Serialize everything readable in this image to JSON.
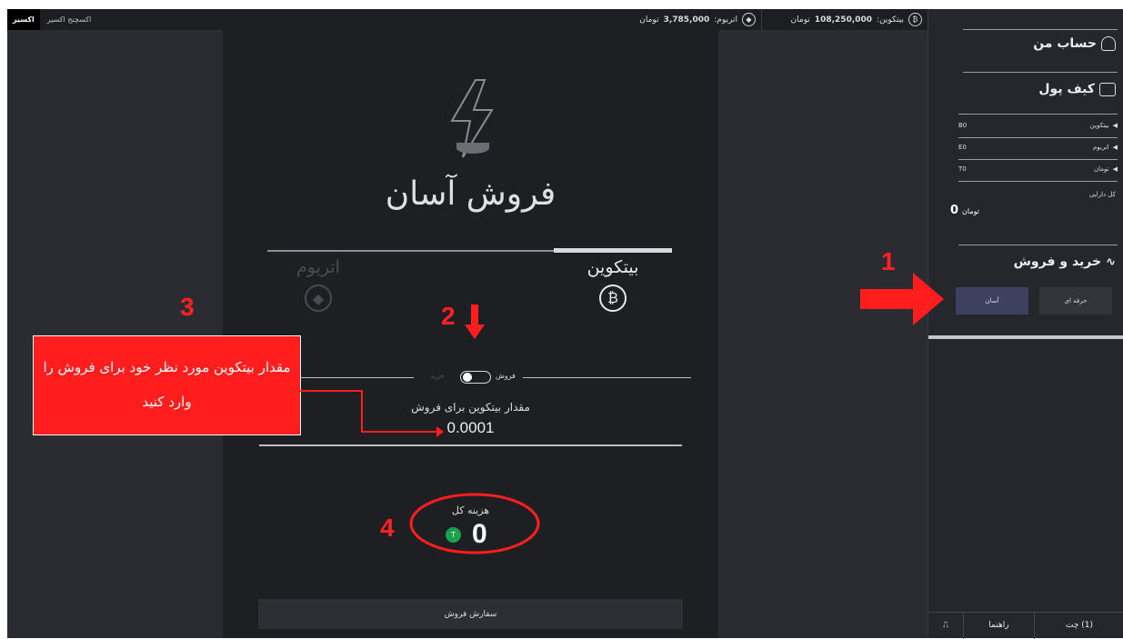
{
  "brand": {
    "name": "اکسیر",
    "subtitle": "اکسچنج اکسیر"
  },
  "ticker": {
    "eth": {
      "label": "اتریوم:",
      "value": "3,785,000",
      "unit": "تومان",
      "icon": "ethereum-icon"
    },
    "btc": {
      "label": "بیتکوین:",
      "value": "108,250,000",
      "unit": "تومان",
      "icon": "bitcoin-icon"
    }
  },
  "main": {
    "title": "فروش آسان",
    "tabs": [
      {
        "label": "بیتکوین",
        "coin": "₿",
        "active": true
      },
      {
        "label": "اتریوم",
        "coin": "◆",
        "active": false
      }
    ],
    "toggle": {
      "sell": "فروش",
      "buy": "خرید"
    },
    "amount_label": "مقدار بیتکوین برای فروش",
    "amount_value": "0.0001",
    "total_label": "هزینه کل",
    "total_badge": "T",
    "total_value": "0",
    "order_button": "سفارش فروش"
  },
  "sidebar": {
    "account": "حساب من",
    "wallet": "کیف پول",
    "balances": [
      {
        "name": "بیتکوین",
        "value": "B0"
      },
      {
        "name": "اتریوم",
        "value": "E0"
      },
      {
        "name": "تومان",
        "value": "T0"
      }
    ],
    "assets_label": "کل دارایی",
    "assets_value": "0",
    "assets_unit": "تومان",
    "trade": "خرید و فروش",
    "mode_pro": "حرفه ای",
    "mode_easy": "آسان",
    "chat": "(1) چت",
    "help": "راهنما"
  },
  "annotations": {
    "n1": "1",
    "n2": "2",
    "n3": "3",
    "n4": "4",
    "callout": "مقدار بیتکوین مورد نظر خود برای فروش را وارد کنید"
  },
  "colors": {
    "accent_red": "#ff1d1d",
    "toman_green": "#1aa24a",
    "bg_dark": "#1e1f23"
  }
}
